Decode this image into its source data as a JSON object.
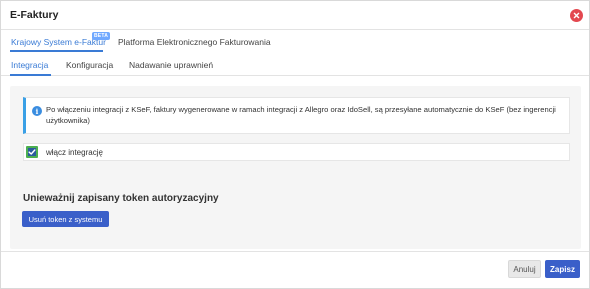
{
  "window": {
    "title": "E-Faktury",
    "close_icon": "close-icon"
  },
  "top_tabs": [
    {
      "label": "Krajowy System e-Faktur",
      "badge": "BETA",
      "active": true
    },
    {
      "label": "Platforma Elektronicznego Fakturowania",
      "active": false
    }
  ],
  "sub_tabs": [
    {
      "label": "Integracja",
      "active": true
    },
    {
      "label": "Konfiguracja",
      "active": false
    },
    {
      "label": "Nadawanie uprawnień",
      "active": false
    }
  ],
  "info": {
    "icon": "info-icon",
    "text": "Po włączeniu integracji z KSeF, faktury wygenerowane w ramach integracji z Allegro oraz IdoSell, są przesyłane automatycznie do KSeF (bez ingerencji użytkownika)"
  },
  "integration_toggle": {
    "label": "włącz integrację",
    "checked": true
  },
  "token_section": {
    "title": "Unieważnij zapisany token autoryzacyjny",
    "button_label": "Usuń token z systemu"
  },
  "footer": {
    "cancel_label": "Anuluj",
    "save_label": "Zapisz"
  },
  "colors": {
    "accent": "#3a7bd5",
    "primary_button": "#3a5fc9",
    "close": "#e34850",
    "info_border": "#3aa0e6",
    "checkbox_border": "#4caf50"
  }
}
